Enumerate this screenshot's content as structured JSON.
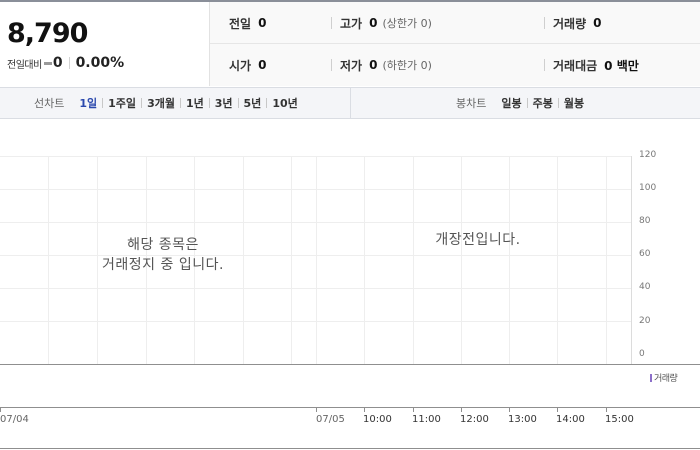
{
  "quote": {
    "price": "8,790",
    "change_label": "전일대비",
    "change_value": "0",
    "change_rate": "0.00%"
  },
  "stats": {
    "prev_close": {
      "label": "전일",
      "value": "0"
    },
    "high": {
      "label": "고가",
      "value": "0",
      "sub": "(상한가 0)"
    },
    "volume": {
      "label": "거래량",
      "value": "0"
    },
    "open": {
      "label": "시가",
      "value": "0"
    },
    "low": {
      "label": "저가",
      "value": "0",
      "sub": "(하한가 0)"
    },
    "trade_amount": {
      "label": "거래대금",
      "value": "0 백만"
    }
  },
  "line_chart_tabs": {
    "title": "선차트",
    "items": [
      "1일",
      "1주일",
      "3개월",
      "1년",
      "3년",
      "5년",
      "10년"
    ],
    "active": "1일"
  },
  "candle_chart_tabs": {
    "title": "봉차트",
    "items": [
      "일봉",
      "주봉",
      "월봉"
    ]
  },
  "chart": {
    "message_suspended_line1": "해당 종목은",
    "message_suspended_line2": "거래정지 중 입니다.",
    "message_pre_market": "개장전입니다.",
    "y_ticks": [
      "120",
      "100",
      "80",
      "60",
      "40",
      "20",
      "0"
    ],
    "legend_volume": "거래량",
    "x_labels": [
      "07/04",
      "07/05",
      "10:00",
      "11:00",
      "12:00",
      "13:00",
      "14:00",
      "15:00"
    ],
    "colors": {
      "grid": "#eeeeee",
      "axis": "#8f8f8f",
      "volume": "#8c6fc9",
      "active_tab": "#2b49ad"
    }
  }
}
